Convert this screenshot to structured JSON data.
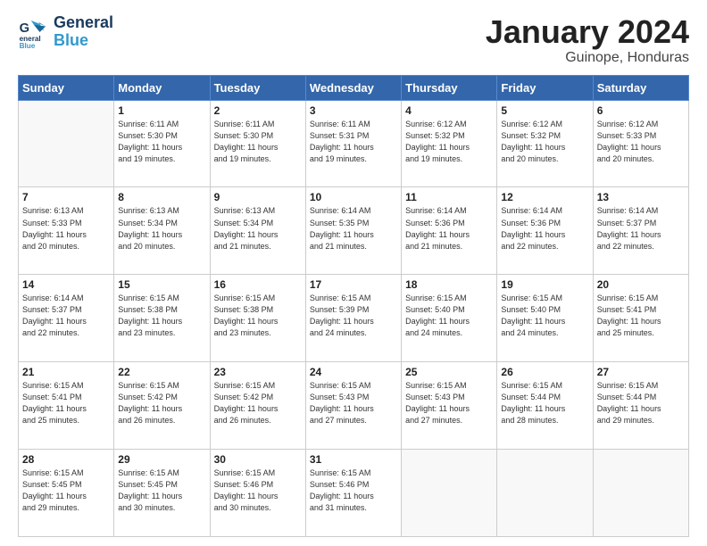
{
  "header": {
    "logo_line1": "General",
    "logo_line2": "Blue",
    "month": "January 2024",
    "location": "Guinope, Honduras"
  },
  "weekdays": [
    "Sunday",
    "Monday",
    "Tuesday",
    "Wednesday",
    "Thursday",
    "Friday",
    "Saturday"
  ],
  "weeks": [
    [
      {
        "day": "",
        "info": ""
      },
      {
        "day": "1",
        "info": "Sunrise: 6:11 AM\nSunset: 5:30 PM\nDaylight: 11 hours\nand 19 minutes."
      },
      {
        "day": "2",
        "info": "Sunrise: 6:11 AM\nSunset: 5:30 PM\nDaylight: 11 hours\nand 19 minutes."
      },
      {
        "day": "3",
        "info": "Sunrise: 6:11 AM\nSunset: 5:31 PM\nDaylight: 11 hours\nand 19 minutes."
      },
      {
        "day": "4",
        "info": "Sunrise: 6:12 AM\nSunset: 5:32 PM\nDaylight: 11 hours\nand 19 minutes."
      },
      {
        "day": "5",
        "info": "Sunrise: 6:12 AM\nSunset: 5:32 PM\nDaylight: 11 hours\nand 20 minutes."
      },
      {
        "day": "6",
        "info": "Sunrise: 6:12 AM\nSunset: 5:33 PM\nDaylight: 11 hours\nand 20 minutes."
      }
    ],
    [
      {
        "day": "7",
        "info": "Sunrise: 6:13 AM\nSunset: 5:33 PM\nDaylight: 11 hours\nand 20 minutes."
      },
      {
        "day": "8",
        "info": "Sunrise: 6:13 AM\nSunset: 5:34 PM\nDaylight: 11 hours\nand 20 minutes."
      },
      {
        "day": "9",
        "info": "Sunrise: 6:13 AM\nSunset: 5:34 PM\nDaylight: 11 hours\nand 21 minutes."
      },
      {
        "day": "10",
        "info": "Sunrise: 6:14 AM\nSunset: 5:35 PM\nDaylight: 11 hours\nand 21 minutes."
      },
      {
        "day": "11",
        "info": "Sunrise: 6:14 AM\nSunset: 5:36 PM\nDaylight: 11 hours\nand 21 minutes."
      },
      {
        "day": "12",
        "info": "Sunrise: 6:14 AM\nSunset: 5:36 PM\nDaylight: 11 hours\nand 22 minutes."
      },
      {
        "day": "13",
        "info": "Sunrise: 6:14 AM\nSunset: 5:37 PM\nDaylight: 11 hours\nand 22 minutes."
      }
    ],
    [
      {
        "day": "14",
        "info": "Sunrise: 6:14 AM\nSunset: 5:37 PM\nDaylight: 11 hours\nand 22 minutes."
      },
      {
        "day": "15",
        "info": "Sunrise: 6:15 AM\nSunset: 5:38 PM\nDaylight: 11 hours\nand 23 minutes."
      },
      {
        "day": "16",
        "info": "Sunrise: 6:15 AM\nSunset: 5:38 PM\nDaylight: 11 hours\nand 23 minutes."
      },
      {
        "day": "17",
        "info": "Sunrise: 6:15 AM\nSunset: 5:39 PM\nDaylight: 11 hours\nand 24 minutes."
      },
      {
        "day": "18",
        "info": "Sunrise: 6:15 AM\nSunset: 5:40 PM\nDaylight: 11 hours\nand 24 minutes."
      },
      {
        "day": "19",
        "info": "Sunrise: 6:15 AM\nSunset: 5:40 PM\nDaylight: 11 hours\nand 24 minutes."
      },
      {
        "day": "20",
        "info": "Sunrise: 6:15 AM\nSunset: 5:41 PM\nDaylight: 11 hours\nand 25 minutes."
      }
    ],
    [
      {
        "day": "21",
        "info": "Sunrise: 6:15 AM\nSunset: 5:41 PM\nDaylight: 11 hours\nand 25 minutes."
      },
      {
        "day": "22",
        "info": "Sunrise: 6:15 AM\nSunset: 5:42 PM\nDaylight: 11 hours\nand 26 minutes."
      },
      {
        "day": "23",
        "info": "Sunrise: 6:15 AM\nSunset: 5:42 PM\nDaylight: 11 hours\nand 26 minutes."
      },
      {
        "day": "24",
        "info": "Sunrise: 6:15 AM\nSunset: 5:43 PM\nDaylight: 11 hours\nand 27 minutes."
      },
      {
        "day": "25",
        "info": "Sunrise: 6:15 AM\nSunset: 5:43 PM\nDaylight: 11 hours\nand 27 minutes."
      },
      {
        "day": "26",
        "info": "Sunrise: 6:15 AM\nSunset: 5:44 PM\nDaylight: 11 hours\nand 28 minutes."
      },
      {
        "day": "27",
        "info": "Sunrise: 6:15 AM\nSunset: 5:44 PM\nDaylight: 11 hours\nand 29 minutes."
      }
    ],
    [
      {
        "day": "28",
        "info": "Sunrise: 6:15 AM\nSunset: 5:45 PM\nDaylight: 11 hours\nand 29 minutes."
      },
      {
        "day": "29",
        "info": "Sunrise: 6:15 AM\nSunset: 5:45 PM\nDaylight: 11 hours\nand 30 minutes."
      },
      {
        "day": "30",
        "info": "Sunrise: 6:15 AM\nSunset: 5:46 PM\nDaylight: 11 hours\nand 30 minutes."
      },
      {
        "day": "31",
        "info": "Sunrise: 6:15 AM\nSunset: 5:46 PM\nDaylight: 11 hours\nand 31 minutes."
      },
      {
        "day": "",
        "info": ""
      },
      {
        "day": "",
        "info": ""
      },
      {
        "day": "",
        "info": ""
      }
    ]
  ]
}
